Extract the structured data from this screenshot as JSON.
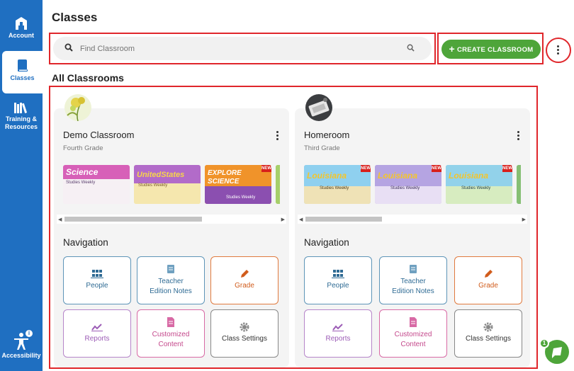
{
  "sidebar": {
    "items": [
      {
        "label": "Account",
        "icon": "account-icon"
      },
      {
        "label": "Classes",
        "icon": "book-icon",
        "active": true
      },
      {
        "label": "Training &",
        "label2": "Resources",
        "icon": "library-icon"
      },
      {
        "label": "Accessibility",
        "icon": "accessibility-icon",
        "badge": "i"
      }
    ]
  },
  "header": {
    "title": "Classes",
    "search_placeholder": "Find Classroom",
    "create_label": "CREATE CLASSROOM",
    "create_plus": "+"
  },
  "section": {
    "title": "All Classrooms"
  },
  "classrooms": [
    {
      "name": "Demo Classroom",
      "grade": "Fourth Grade",
      "covers": [
        {
          "title": "Science",
          "subtitle": "Studies Weekly"
        },
        {
          "title": "UnitedStates",
          "subtitle": "Studies Weekly"
        },
        {
          "title": "EXPLORE SCIENCE",
          "subtitle": "Studies Weekly",
          "badge": "NEW"
        },
        {
          "title": "",
          "subtitle": ""
        }
      ],
      "navigation_title": "Navigation",
      "nav": {
        "people": "People",
        "teacher_1": "Teacher",
        "teacher_2": "Edition Notes",
        "grade": "Grade",
        "reports": "Reports",
        "custom_1": "Customized",
        "custom_2": "Content",
        "settings": "Class Settings"
      }
    },
    {
      "name": "Homeroom",
      "grade": "Third Grade",
      "covers": [
        {
          "title": "Louisiana",
          "subtitle": "Studies Weekly",
          "badge": "NEW"
        },
        {
          "title": "Louisiana",
          "subtitle": "Studies Weekly",
          "badge": "NEW"
        },
        {
          "title": "Louisiana",
          "subtitle": "Studies Weekly",
          "badge": "NEW"
        },
        {
          "title": "",
          "subtitle": ""
        }
      ],
      "navigation_title": "Navigation",
      "nav": {
        "people": "People",
        "teacher_1": "Teacher",
        "teacher_2": "Edition Notes",
        "grade": "Grade",
        "reports": "Reports",
        "custom_1": "Customized",
        "custom_2": "Content",
        "settings": "Class Settings"
      }
    }
  ],
  "chat": {
    "badge_count": "1"
  },
  "colors": {
    "brand_blue": "#1f6fc1",
    "accent_green": "#4ea53a",
    "highlight_red": "#e0262b"
  }
}
